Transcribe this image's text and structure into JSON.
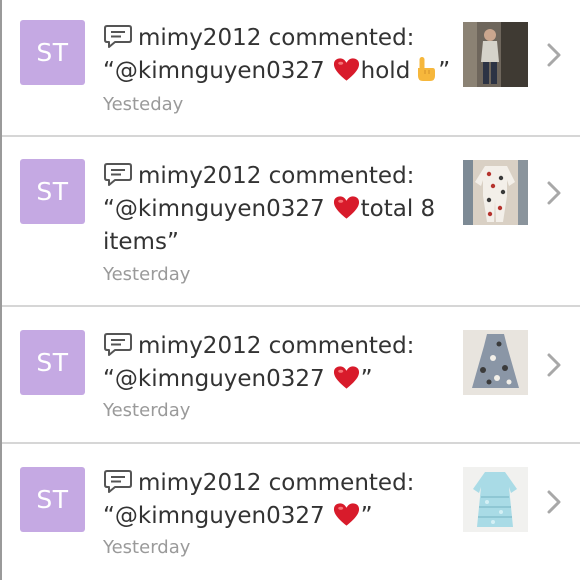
{
  "notifications": [
    {
      "avatar_initials": "ST",
      "actor": "mimy2012 commented:",
      "line1_text": "“@kimnguyen0327",
      "line1_after": "hold",
      "line1_end": "”",
      "line2_text": "",
      "time": "Yesteday",
      "thumbnail_icon": "person-photo-thumbnail",
      "trailing_emoji": "pointing-finger"
    },
    {
      "avatar_initials": "ST",
      "actor": "mimy2012 commented:",
      "line1_text": "“@kimnguyen0327",
      "line1_after": "total 8",
      "line1_end": "",
      "line2_text": "items”",
      "time": "Yesterday",
      "thumbnail_icon": "pajamas-photo-thumbnail",
      "trailing_emoji": ""
    },
    {
      "avatar_initials": "ST",
      "actor": "mimy2012 commented:",
      "line1_text": "“@kimnguyen0327",
      "line1_after": "",
      "line1_end": "”",
      "line2_text": "",
      "time": "Yesterday",
      "thumbnail_icon": "dress-photo-thumbnail",
      "trailing_emoji": ""
    },
    {
      "avatar_initials": "ST",
      "actor": "mimy2012 commented:",
      "line1_text": "“@kimnguyen0327",
      "line1_after": "",
      "line1_end": "”",
      "line2_text": "",
      "time": "Yesterday",
      "thumbnail_icon": "lace-dress-photo-thumbnail",
      "trailing_emoji": ""
    }
  ],
  "colors": {
    "avatar_bg": "#c5a9e3",
    "heart": "#d81b2b",
    "text": "#333333",
    "muted": "#9a9a9a",
    "divider": "#d6d6d6",
    "chevron": "#a8a8a8"
  }
}
